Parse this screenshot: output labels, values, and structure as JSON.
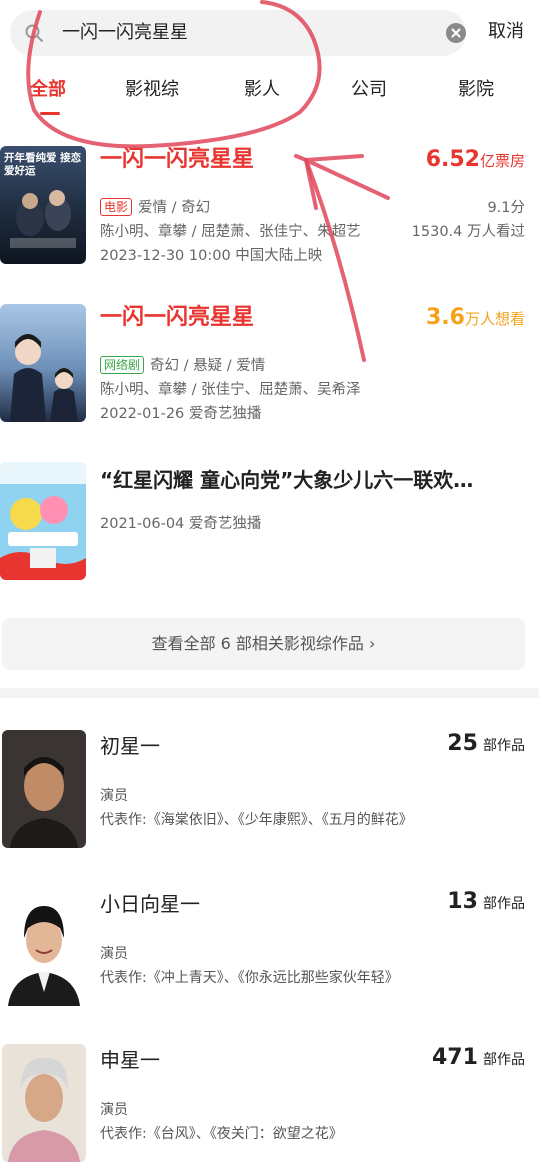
{
  "search": {
    "query": "一闪一闪亮星星",
    "cancel_label": "取消"
  },
  "tabs": [
    {
      "label": "全部",
      "active": true
    },
    {
      "label": "影视综",
      "active": false
    },
    {
      "label": "影人",
      "active": false
    },
    {
      "label": "公司",
      "active": false
    },
    {
      "label": "影院",
      "active": false
    }
  ],
  "media": [
    {
      "title": "一闪一闪亮星星",
      "metric_value": "6.52",
      "metric_unit": "亿票房",
      "tag": "电影",
      "genres": "爱情 / 奇幻",
      "score": "9.1分",
      "cast": "陈小明、章攀 / 屈楚萧、张佳宁、朱超艺",
      "views": "1530.4 万人看过",
      "release": "2023-12-30 10:00 中国大陆上映",
      "poster_text": "开年看纯爱 接恋爱好运"
    },
    {
      "title": "一闪一闪亮星星",
      "metric_value": "3.6",
      "metric_unit": "万人想看",
      "tag": "网络剧",
      "genres": "奇幻 / 悬疑 / 爱情",
      "cast": "陈小明、章攀 / 张佳宁、屈楚萧、吴希泽",
      "release": "2022-01-26 爱奇艺独播"
    },
    {
      "title": "“红星闪耀 童心向党”大象少儿六一联欢…",
      "release": "2021-06-04 爱奇艺独播"
    }
  ],
  "view_all_label": "查看全部 6 部相关影视综作品 ›",
  "people": [
    {
      "name": "初星一",
      "count": "25",
      "count_unit": "部作品",
      "role": "演员",
      "works_label": "代表作:",
      "works": "《海棠依旧》、《少年康熙》、《五月的鲜花》"
    },
    {
      "name": "小日向星一",
      "count": "13",
      "count_unit": "部作品",
      "role": "演员",
      "works_label": "代表作:",
      "works": "《冲上青天》、《你永远比那些家伙年轻》"
    },
    {
      "name": "申星一",
      "count": "471",
      "count_unit": "部作品",
      "role": "演员",
      "works_label": "代表作:",
      "works": "《台风》、《夜关门：欲望之花》"
    }
  ],
  "colors": {
    "accent_red": "#e8352f",
    "want_orange": "#f3a21a",
    "tag_green": "#3aa84a"
  }
}
